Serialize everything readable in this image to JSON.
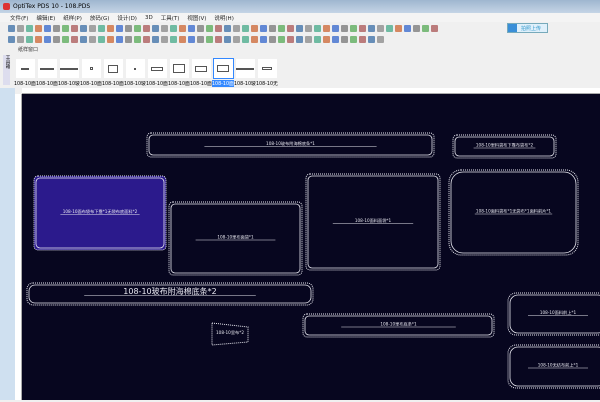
{
  "window": {
    "title": "OptiTex PDS 10 - 108.PDS"
  },
  "menu": [
    "文件(F)",
    "编辑(E)",
    "纸样(P)",
    "放码(G)",
    "设计(D)",
    "3D",
    "工具(T)",
    "视图(V)",
    "说明(H)"
  ],
  "upload_button": "拍照上传",
  "pattern_window": {
    "label": "纸样窗口",
    "side_tabs": [
      "工具箱",
      "纸样窗"
    ]
  },
  "thumbnails": [
    {
      "label": "108-10面"
    },
    {
      "label": "108-10面"
    },
    {
      "label": "108-10玻"
    },
    {
      "label": "108-10面"
    },
    {
      "label": "108-10面"
    },
    {
      "label": "108-10玻"
    },
    {
      "label": "108-10面"
    },
    {
      "label": "108-10面"
    },
    {
      "label": "108-10面"
    },
    {
      "label": "108-10面",
      "selected": true
    },
    {
      "label": "108-10玻"
    },
    {
      "label": "108-10无"
    }
  ],
  "pieces": [
    {
      "label": "108-10玻布附海棉底条*1"
    },
    {
      "label": "108-10里料袋布下靠布袋布*2"
    },
    {
      "label": "108-10面布袋布下靠*1无袋布底面料*2",
      "selected": true
    },
    {
      "label": "108-10里布面袋*1"
    },
    {
      "label": "108-10面料面袋*1"
    },
    {
      "label": "108-10面料袋布*1无袋布*1面料前片*1"
    },
    {
      "label": "108-10玻布附海棉底条*2"
    },
    {
      "label": "108-10里布*2"
    },
    {
      "label": "108-10里布底条*1"
    },
    {
      "label": "108-10面料前上*1"
    },
    {
      "label": "108-10无纺布前上*1"
    }
  ],
  "colors": {
    "canvas": "#07061f",
    "selected_fill": "#2b1a8c",
    "outline": "#e8e8f0"
  }
}
